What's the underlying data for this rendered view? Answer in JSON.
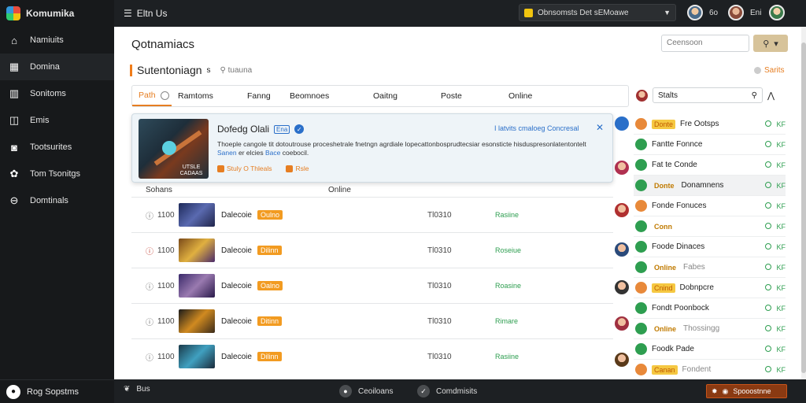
{
  "app": {
    "brand": "Komumika"
  },
  "sidebar": {
    "items": [
      {
        "label": "Namiuits",
        "icon": "home-icon",
        "glyph": "⌂"
      },
      {
        "label": "Domina",
        "icon": "grid-icon",
        "glyph": "▦"
      },
      {
        "label": "Sonitoms",
        "icon": "bars-icon",
        "glyph": "▥"
      },
      {
        "label": "Emis",
        "icon": "chat-icon",
        "glyph": "◫"
      },
      {
        "label": "Tootsurites",
        "icon": "media-icon",
        "glyph": "◙"
      },
      {
        "label": "Tom Tsonitgs",
        "icon": "gear-icon",
        "glyph": "✿"
      },
      {
        "label": "Domtinals",
        "icon": "link-icon",
        "glyph": "⊖"
      }
    ],
    "footer": "Rog Sopstms"
  },
  "topbar": {
    "title": "Eltn Us",
    "search_value": "Obnsomsts Det sEMoawe",
    "user1": "6o",
    "user2": "Eni"
  },
  "main": {
    "page_title": "Qotnamiacs",
    "search_placeholder": "Ceensoon",
    "section_title": "Sutentoniagn",
    "section_badge": "s",
    "section_sub": "tuauna",
    "right_link": "Sarits",
    "tabs": [
      "Path",
      "Ramtoms",
      "Fanng",
      "Beomnoes",
      "Oaitng",
      "Poste",
      "Online"
    ],
    "rp_input": "Stalts"
  },
  "card": {
    "title": "Dofedg Olali",
    "tag": "Ena",
    "link": "I latvits cmaloeg Concresal",
    "description_pre": "Thoeple cangole tit dotoutrouse proceshetrale fnetngn agrdiale lopecattonbosprudtecsiar esonsticte hisduspresonlatentontelt",
    "description_hl": "Sanen",
    "description_mid": "er elcies",
    "description_hl2": "Bace",
    "description_post": "coebocil.",
    "meta1": "Stuly O Thleals",
    "meta2": "Rsle",
    "image_caption": "UTSLE CADAAS"
  },
  "table": {
    "headers": [
      "Sohans",
      "Online"
    ],
    "rows": [
      {
        "num": "1100",
        "name": "Dalecoie",
        "tag": "Oulno",
        "time": "Tl0310",
        "status": "Rasiine",
        "icon_color": "normal"
      },
      {
        "num": "1100",
        "name": "Dalecoie",
        "tag": "Dilinn",
        "time": "Tl0310",
        "status": "Roseiue",
        "icon_color": "red"
      },
      {
        "num": "1100",
        "name": "Dalecoie",
        "tag": "Oalno",
        "time": "Tl0310",
        "status": "Roasine",
        "icon_color": "normal"
      },
      {
        "num": "1100",
        "name": "Dalecoie",
        "tag": "Ditinn",
        "time": "Tl0310",
        "status": "Rimare",
        "icon_color": "normal"
      },
      {
        "num": "1100",
        "name": "Dalecoie",
        "tag": "Dilinn",
        "time": "Tl0310",
        "status": "Rasiine",
        "icon_color": "normal"
      }
    ]
  },
  "right_panel": {
    "rows": [
      {
        "badge": "Donte",
        "name": "Fre Ootsps",
        "style": "o",
        "hl": false
      },
      {
        "badge": "",
        "name": "Fantte Fonnce",
        "style": "g",
        "hl": false
      },
      {
        "badge": "",
        "name": "Fat te Conde",
        "style": "g",
        "hl": false
      },
      {
        "badge": "Donte",
        "name": "Donamnens",
        "style": "g",
        "hl": true
      },
      {
        "badge": "",
        "name": "Fonde Fonuces",
        "style": "o",
        "hl": false
      },
      {
        "badge": "Conn",
        "name": "",
        "style": "g",
        "hl": false
      },
      {
        "badge": "",
        "name": "Foode Dinaces",
        "style": "g",
        "hl": false
      },
      {
        "badge": "Online",
        "name": "Fabes",
        "style": "g",
        "hl": false,
        "grey": true
      },
      {
        "badge": "Cnind",
        "name": "Dobnpcre",
        "style": "o",
        "hl": false
      },
      {
        "badge": "",
        "name": "Fondt Poonbock",
        "style": "g",
        "hl": false
      },
      {
        "badge": "Online",
        "name": "Thossingg",
        "style": "g",
        "hl": false,
        "grey": true
      },
      {
        "badge": "",
        "name": "Foodk Pade",
        "style": "g",
        "hl": false
      },
      {
        "badge": "Canan",
        "name": "Fondent",
        "style": "o",
        "hl": false,
        "grey": true
      }
    ],
    "flag_label": "KF"
  },
  "bottombar": {
    "left": "Bus",
    "mid1": "Ceoiloans",
    "mid2": "Comdmisits",
    "button": "Spooostnne"
  },
  "colors": {
    "accent": "#e67e22",
    "sidebar": "#17191b",
    "green": "#2e9e50",
    "blue": "#2a6fc9"
  }
}
